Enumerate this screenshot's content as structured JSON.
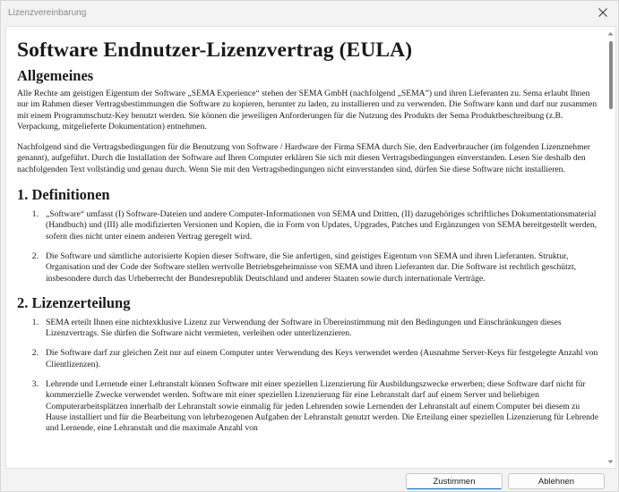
{
  "window": {
    "title": "Lizenzvereinbarung"
  },
  "document": {
    "title": "Software Endnutzer-Lizenzvertrag (EULA)",
    "general_heading": "Allgemeines",
    "general_paragraphs": [
      "Alle Rechte am geistigen Eigentum der Software „SEMA Experience“ stehen der SEMA GmbH (nachfolgend „SEMA”) und ihren Lieferanten zu. Sema erlaubt Ihnen nur im Rahmen dieser Vertragsbestimmungen die Software zu kopieren, herunter zu laden, zu installieren und zu verwenden. Die Software kann und darf nur zusammen mit einem Programmschutz-Key benutzt werden. Sie können die jeweiligen Anforderungen für die Nutzung des Produkts der Sema Produktbeschreibung (z.B. Verpackung, mitgelieferte Dokumentation) entnehmen.",
      "Nachfolgend sind die Vertragsbedingungen für die Benutzung von Software / Hardware der Firma SEMA durch Sie, den Endverbraucher (im folgenden Lizenznehmer genannt), aufgeführt. Durch die Installation der Software auf Ihren Computer erklären Sie sich mit diesen Vertragsbedingungen einverstanden. Lesen Sie deshalb den nachfolgenden Text vollständig und genau durch. Wenn Sie mit den Vertragsbedingungen nicht einverstanden sind, dürfen Sie diese Software nicht installieren."
    ],
    "sections": [
      {
        "heading": "1. Definitionen",
        "items": [
          {
            "num": "1.",
            "text": "„Software“ umfasst (I) Software-Dateien und andere Computer-Informationen von SEMA und Dritten, (II) dazugehöriges schriftliches Dokumentationsmaterial (Handbuch) und (III) alle modifizierten Versionen und Kopien, die in Form von Updates, Upgrades, Patches und Ergänzungen von SEMA bereitgestellt werden, sofern dies nicht unter einem anderen Vertrag geregelt wird."
          },
          {
            "num": "2.",
            "text": "Die Software und sämtliche autorisierte Kopien dieser Software, die Sie anfertigen, sind geistiges Eigentum von SEMA und ihren Lieferanten. Struktur, Organisation und der Code der Software stellen wertvolle Betriebsgeheimnisse von SEMA und ihren Lieferanten dar. Die Software ist rechtlich geschützt, insbesondere durch das Urheberrecht der Bundesrepublik Deutschland und anderer Staaten sowie durch internationale Verträge."
          }
        ]
      },
      {
        "heading": "2. Lizenzerteilung",
        "items": [
          {
            "num": "1.",
            "text": "SEMA erteilt Ihnen eine nichtexklusive Lizenz zur Verwendung der Software in Übereinstimmung mit den Bedingungen und Einschränkungen dieses Lizenzvertrags. Sie dürfen die Software nicht vermieten, verleihen oder unterlizenzieren."
          },
          {
            "num": "2.",
            "text": "Die Software darf zur gleichen Zeit nur auf einem Computer unter Verwendung des Keys verwendet werden (Ausnahme Server-Keys für festgelegte Anzahl von Clientlizenzen)."
          },
          {
            "num": "3.",
            "text": "Lehrende und Lernende einer Lehranstalt können Software mit einer speziellen Lizenzierung für Ausbildungszwecke erwerben; diese Software darf nicht für kommerzielle Zwecke verwendet werden. Software mit einer speziellen Lizenzierung für eine Lehranstalt darf auf einem Server und beliebigen Computerarbeitsplätzen innerhalb der Lehranstalt sowie einmalig für jeden Lehrenden sowie Lernenden der Lehranstalt auf einem Computer bei diesem zu Hause installiert und für die Bearbeitung von lehrbezogenen Aufgaben der Lehranstalt genutzt werden. Die Erteilung einer speziellen Lizenzierung für Lehrende und Lernende, eine Lehranstalt und die maximale Anzahl von"
          }
        ]
      }
    ]
  },
  "buttons": {
    "accept": "Zustimmen",
    "decline": "Ablehnen"
  },
  "icons": {
    "close": "close-icon",
    "scroll_up": "chevron-up-icon",
    "scroll_down": "chevron-down-icon"
  },
  "colors": {
    "accent": "#0067c0",
    "window_bg": "#f3f3f3",
    "content_bg": "#ffffff"
  }
}
